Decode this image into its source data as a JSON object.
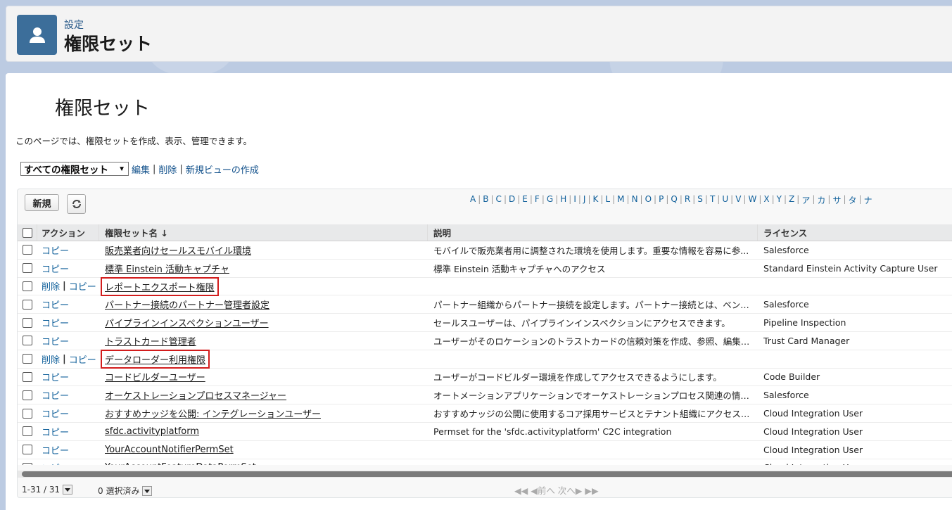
{
  "header": {
    "breadcrumb": "設定",
    "title": "権限セット",
    "icon": "user-icon"
  },
  "page": {
    "title": "権限セット",
    "description": "このページでは、権限セットを作成、表示、管理できます。"
  },
  "view": {
    "selected": "すべての権限セット",
    "edit": "編集",
    "delete": "削除",
    "new_view": "新規ビューの作成"
  },
  "toolbar": {
    "new_label": "新規"
  },
  "alphabet": [
    "A",
    "B",
    "C",
    "D",
    "E",
    "F",
    "G",
    "H",
    "I",
    "J",
    "K",
    "L",
    "M",
    "N",
    "O",
    "P",
    "Q",
    "R",
    "S",
    "T",
    "U",
    "V",
    "W",
    "X",
    "Y",
    "Z",
    "ア",
    "カ",
    "サ",
    "タ",
    "ナ"
  ],
  "columns": {
    "action": "アクション",
    "name": "権限セット名 ↓",
    "description": "説明",
    "license": "ライセンス"
  },
  "actions": {
    "copy": "コピー",
    "delete": "削除"
  },
  "rows": [
    {
      "name": "販売業者向けセールスモバイル環境",
      "description": "モバイルで販売業者用に調整された環境を使用します。重要な情報を容易に参...",
      "license": "Salesforce",
      "deletable": false,
      "highlight": false
    },
    {
      "name": "標準 Einstein 活動キャプチャ",
      "description": "標準 Einstein 活動キャプチャへのアクセス",
      "license": "Standard Einstein Activity Capture User",
      "deletable": false,
      "highlight": false
    },
    {
      "name": "レポートエクスポート権限",
      "description": "",
      "license": "",
      "deletable": true,
      "highlight": true
    },
    {
      "name": "パートナー接続のパートナー管理者設定",
      "description": "パートナー組織からパートナー接続を設定します。パートナー接続とは、ベンダーとパ...",
      "license": "Salesforce",
      "deletable": false,
      "highlight": false
    },
    {
      "name": "パイプラインインスペクションユーザー",
      "description": "セールスユーザーは、パイプラインインスペクションにアクセスできます。",
      "license": "Pipeline Inspection",
      "deletable": false,
      "highlight": false
    },
    {
      "name": "トラストカード管理者",
      "description": "ユーザーがそのロケーションのトラストカードの信頼対策を作成、参照、編集、削除...",
      "license": "Trust Card Manager",
      "deletable": false,
      "highlight": false
    },
    {
      "name": "データローダー利用権限",
      "description": "",
      "license": "",
      "deletable": true,
      "highlight": true
    },
    {
      "name": "コードビルダーユーザー",
      "description": "ユーザーがコードビルダー環境を作成してアクセスできるようにします。",
      "license": "Code Builder",
      "deletable": false,
      "highlight": false
    },
    {
      "name": "オーケストレーションプロセスマネージャー",
      "description": "オートメーションアプリケーションでオーケストレーションプロセス関連の情報を管理し...",
      "license": "Salesforce",
      "deletable": false,
      "highlight": false
    },
    {
      "name": "おすすめナッジを公開: インテグレーションユーザー",
      "description": "おすすめナッジの公開に使用するコア採用サービスとテナント組織にアクセスします。",
      "license": "Cloud Integration User",
      "deletable": false,
      "highlight": false
    },
    {
      "name": "sfdc.activityplatform",
      "description": "Permset for the 'sfdc.activityplatform' C2C integration",
      "license": "Cloud Integration User",
      "deletable": false,
      "highlight": false
    },
    {
      "name": "YourAccountNotifierPermSet",
      "description": "",
      "license": "Cloud Integration User",
      "deletable": false,
      "highlight": false
    },
    {
      "name": "YourAccountFeatureDataPermSet",
      "description": "",
      "license": "Cloud Integration User",
      "deletable": false,
      "highlight": false
    }
  ],
  "footer": {
    "count": "1-31 / 31",
    "selected": "0 選択済み",
    "pager": "◀◀ ◀前へ 次へ▶ ▶▶"
  }
}
